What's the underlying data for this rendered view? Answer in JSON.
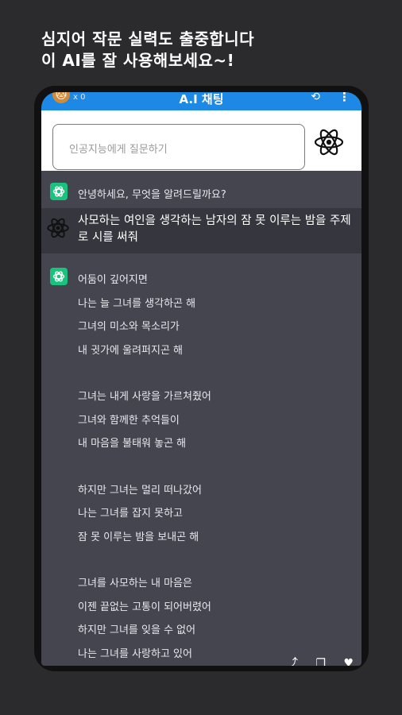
{
  "promo": {
    "line1": "심지어 작문 실력도 출중합니다",
    "line2": "이 AI를 잘 사용해보세요~!"
  },
  "appbar": {
    "title": "A.I 채팅",
    "points": "x 0"
  },
  "input": {
    "placeholder": "인공지능에게 질문하기"
  },
  "chat": {
    "greeting": "안녕하세요, 무엇을 알려드릴까요?",
    "user_message": "사모하는 여인을 생각하는 남자의 잠 못 이루는 밤을 주제로 시를 써줘",
    "poem": [
      "어둠이 깊어지면",
      "나는 늘 그녀를 생각하곤 해",
      "그녀의 미소와 목소리가",
      "내 귓가에 울려퍼지곤 해",
      "",
      "그녀는 내게 사랑을 가르쳐줬어",
      "그녀와 함께한 추억들이",
      "내 마음을 불태워 놓곤 해",
      "",
      "하지만 그녀는 멀리 떠나갔어",
      "나는 그녀를 잡지 못하고",
      "잠 못 이루는 밤을 보내곤 해",
      "",
      "그녀를 사모하는 내 마음은",
      "이젠 끝없는 고통이 되어버렸어",
      "하지만 그녀를 잊을 수 없어",
      "나는 그녀를 사랑하고 있어"
    ]
  },
  "icons": {
    "atom": "atom-icon",
    "gpt": "openai-logo-icon",
    "cat": "cat-avatar-icon",
    "history": "history-icon",
    "more": "more-vert-icon",
    "share": "share-icon",
    "copy": "copy-icon",
    "like": "heart-icon"
  },
  "colors": {
    "appbar": "#1e88e5",
    "chat_bg": "#45454f",
    "user_row": "#36363f",
    "gpt_green": "#19c37d"
  }
}
